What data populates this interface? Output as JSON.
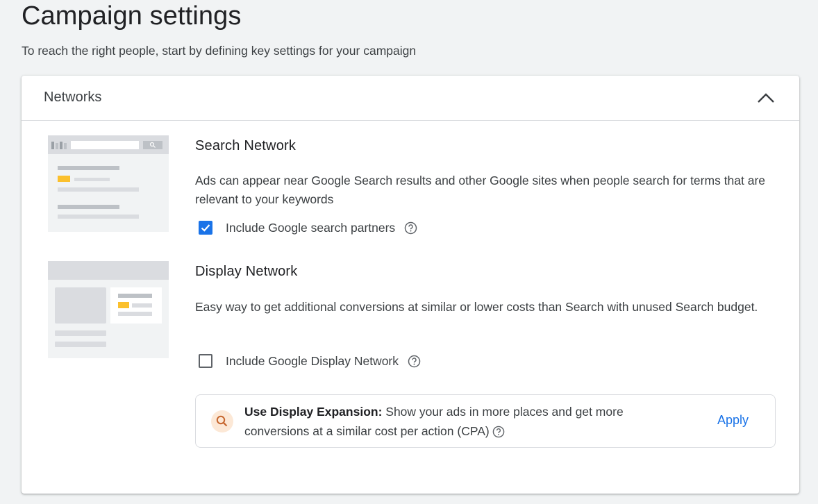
{
  "page": {
    "title": "Campaign settings",
    "subtitle": "To reach the right people, start by defining key settings for your campaign"
  },
  "networks": {
    "title": "Networks",
    "collapse_icon": "chevron-up-icon",
    "search": {
      "title": "Search Network",
      "description": "Ads can appear near Google Search results and other Google sites when people search for terms that are relevant to your keywords",
      "checkbox_label": "Include Google search partners",
      "checked": true,
      "help_icon": "help-circle-icon"
    },
    "display": {
      "title": "Display Network",
      "description": "Easy way to get additional conversions at similar or lower costs than Search with unused Search budget.",
      "checkbox_label": "Include Google Display Network",
      "checked": false,
      "help_icon": "help-circle-icon"
    },
    "expansion": {
      "icon": "search-icon",
      "bold_label": "Use Display Expansion:",
      "text": " Show your ads in more places and get more conversions at a similar cost per action (CPA)",
      "apply_label": "Apply"
    }
  },
  "colors": {
    "accent": "#1a73e8",
    "highlight_yellow": "#fbc02d",
    "expansion_icon_bg": "#fce8d6",
    "expansion_icon_fg": "#c5642b"
  }
}
